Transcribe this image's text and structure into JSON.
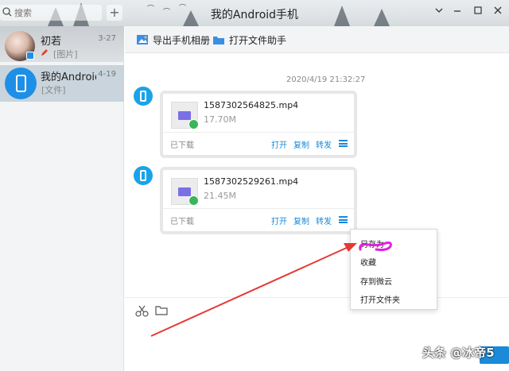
{
  "window": {
    "title": "我的Android手机",
    "controls": [
      "chevron-down",
      "minimize",
      "maximize",
      "close"
    ]
  },
  "search": {
    "placeholder": "搜索"
  },
  "sidebar": {
    "add_label": "+",
    "contacts": [
      {
        "name": "初若",
        "sub": "[图片]",
        "time": "3-27"
      },
      {
        "name": "我的Android手机",
        "sub": "[文件]",
        "time": "4-19"
      }
    ]
  },
  "toolbar": {
    "export_label": "导出手机相册",
    "open_assistant_label": "打开文件助手"
  },
  "chat": {
    "timestamp": "2020/4/19 21:32:27",
    "messages": [
      {
        "file_name": "1587302564825.mp4",
        "file_size": "17.70M",
        "status": "已下载",
        "actions": [
          "打开",
          "复制",
          "转发"
        ]
      },
      {
        "file_name": "1587302529261.mp4",
        "file_size": "21.45M",
        "status": "已下载",
        "actions": [
          "打开",
          "复制",
          "转发"
        ]
      }
    ]
  },
  "context_menu": {
    "items": [
      "另存为",
      "收藏",
      "存到微云",
      "打开文件夹"
    ]
  },
  "watermark": "头条 @冰帝5",
  "colors": {
    "accent": "#1a8ad9",
    "avatar_blue": "#1e8fe6",
    "check_green": "#3cb55a",
    "video_purple": "#7b6fe6",
    "annotation_red": "#e53935",
    "scribble_magenta": "#e020e0"
  }
}
